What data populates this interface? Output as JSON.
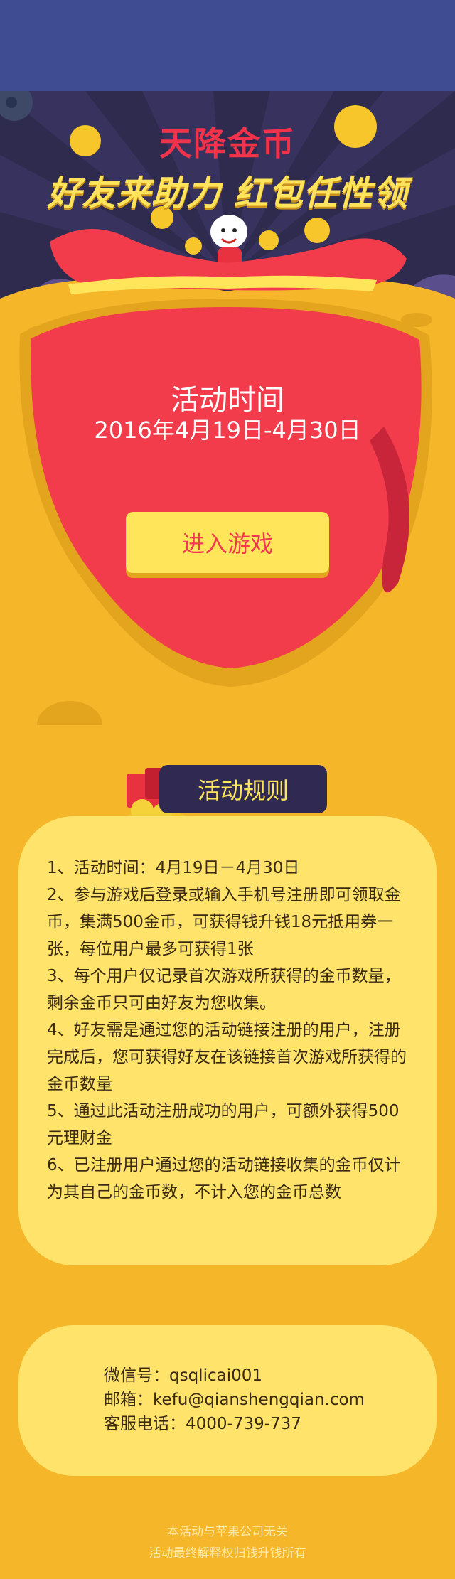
{
  "hero": {
    "title": "天降金币",
    "subtitle": "好友来助力  红包任性领"
  },
  "activity": {
    "time_title": "活动时间",
    "time_range": "2016年4月19日-4月30日",
    "enter_button": "进入游戏"
  },
  "rules": {
    "heading": "活动规则",
    "items": [
      "1、活动时间：4月19日－4月30日",
      "2、参与游戏后登录或输入手机号注册即可领取金币，集满500金币，可获得钱升钱18元抵用券一张，每位用户最多可获得1张",
      "3、每个用户仅记录首次游戏所获得的金币数量，剩余金币只可由好友为您收集。",
      "4、好友需是通过您的活动链接注册的用户，注册完成后，您可获得好友在该链接首次游戏所获得的金币数量",
      "5、通过此活动注册成功的用户，可额外获得500元理财金",
      "6、已注册用户通过您的活动链接收集的金币仅计为其自己的金币数，不计入您的金币总数"
    ]
  },
  "contact": {
    "wechat": "微信号：qsqlicai001",
    "email": "邮箱：kefu@qianshengqian.com",
    "phone": "客服电话：4000-739-737"
  },
  "footer": {
    "line1": "本活动与苹果公司无关",
    "line2": "活动最终解释权归钱升钱所有"
  },
  "colors": {
    "top_bar": "#3F4C91",
    "hero_bg": "#2F2B4E",
    "page_bg": "#F6B62A",
    "bag_red": "#F23C4C",
    "button_yellow": "#FFE55A",
    "card_yellow": "#FFE36B"
  }
}
